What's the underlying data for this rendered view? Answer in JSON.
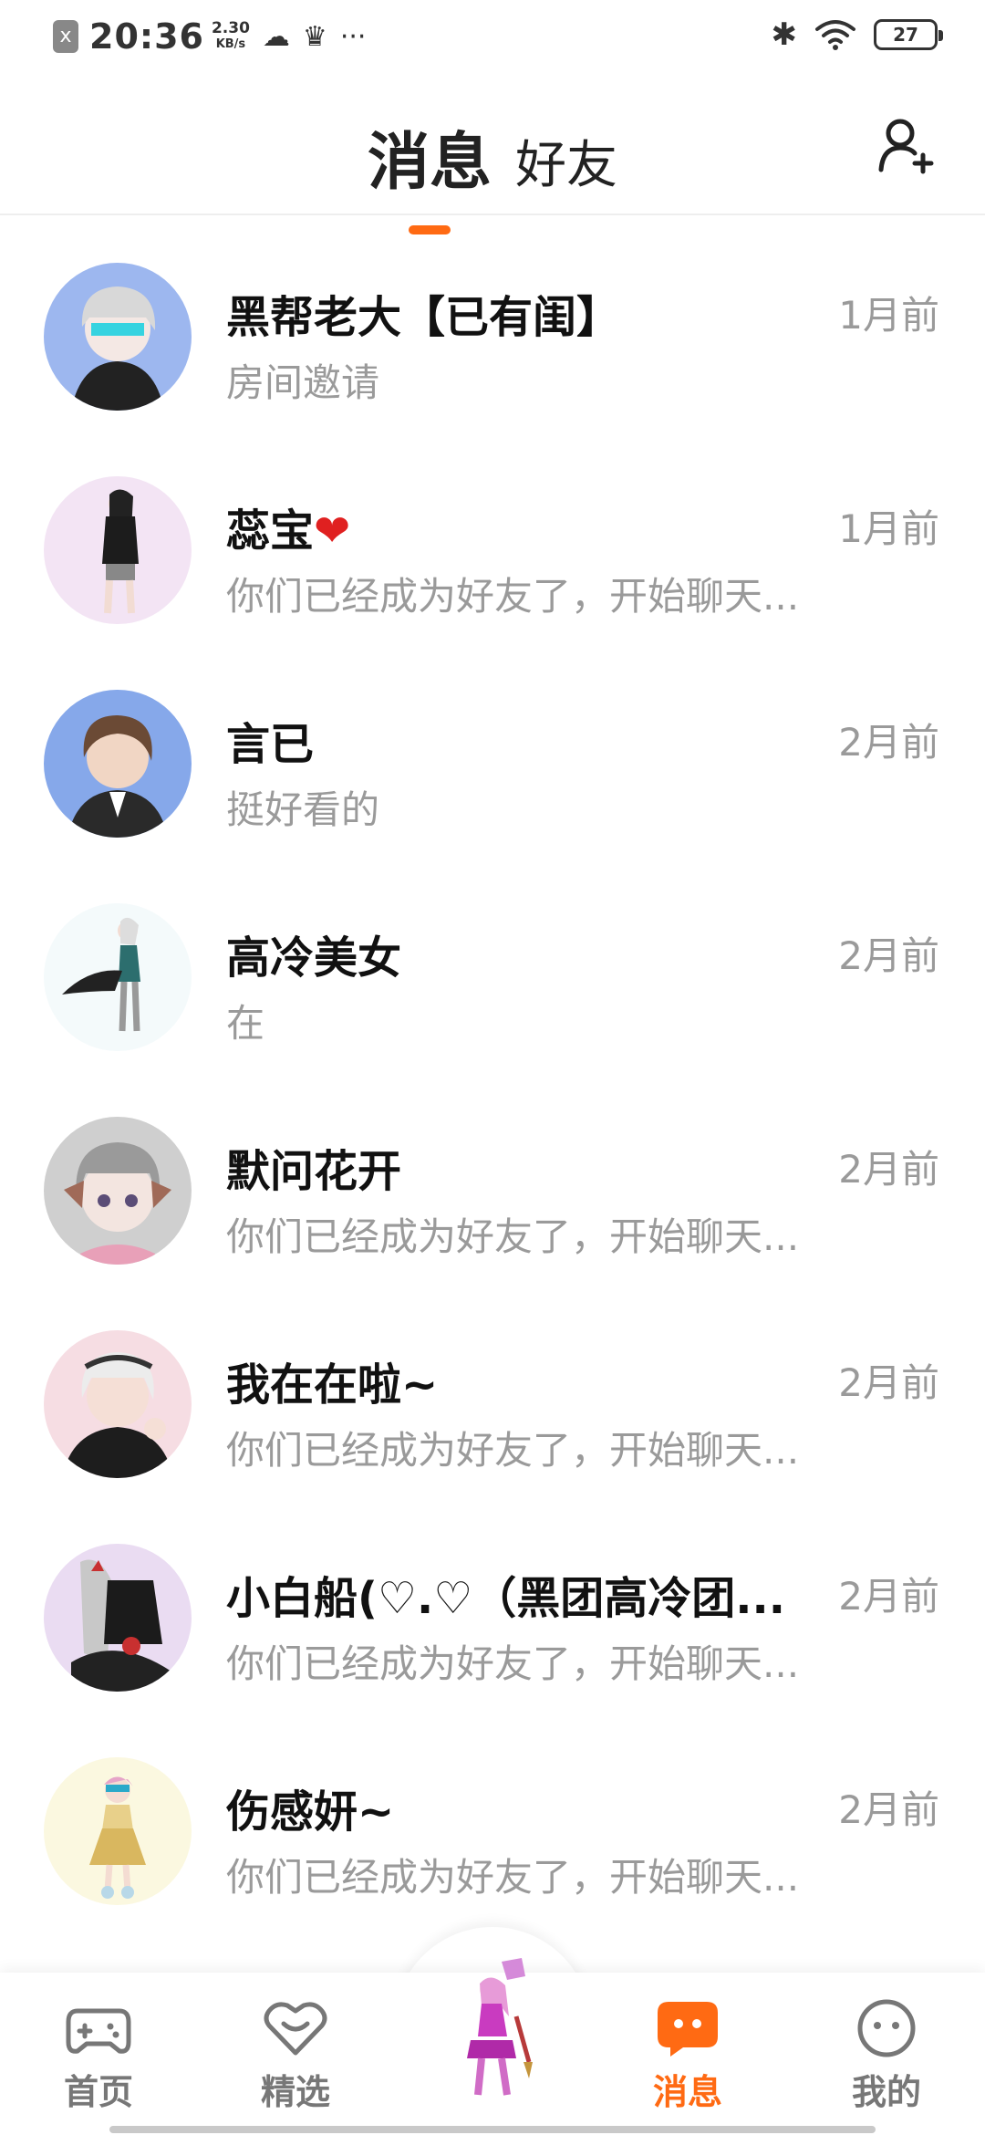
{
  "status_bar": {
    "close_icon_glyph": "x",
    "time": "20:36",
    "speed_value": "2.30",
    "speed_unit": "KB/s",
    "icons": [
      "cloud-icon",
      "crown-icon",
      "more-icon"
    ],
    "right_icons": [
      "bluetooth-icon",
      "wifi-icon",
      "battery-icon"
    ],
    "battery": "27"
  },
  "header": {
    "tabs": [
      {
        "label": "消息",
        "active": true
      },
      {
        "label": "好友",
        "active": false
      }
    ],
    "accent_color": "#ff6a13",
    "add_friend_icon": "add-user-icon"
  },
  "conversations": [
    {
      "name": "黑帮老大【已有闺】",
      "preview": "房间邀请",
      "time": "1月前"
    },
    {
      "name": "蕊宝",
      "name_suffix": "❤",
      "preview": "你们已经成为好友了，开始聊天...",
      "time": "1月前"
    },
    {
      "name": "言已",
      "preview": "挺好看的",
      "time": "2月前"
    },
    {
      "name": "高冷美女",
      "preview": "在",
      "time": "2月前"
    },
    {
      "name": "默问花开",
      "preview": "你们已经成为好友了，开始聊天...",
      "time": "2月前"
    },
    {
      "name": "我在在啦~",
      "preview": "你们已经成为好友了，开始聊天...",
      "time": "2月前"
    },
    {
      "name": "小白船(♡.♡（黑团高冷团...",
      "preview": "你们已经成为好友了，开始聊天...",
      "time": "2月前"
    },
    {
      "name": "伤感妍~",
      "preview": "你们已经成为好友了，开始聊天...",
      "time": "2月前"
    }
  ],
  "bottom_nav": {
    "items": [
      {
        "label": "首页",
        "icon": "gamepad-icon",
        "active": false
      },
      {
        "label": "精选",
        "icon": "heart-badge-icon",
        "active": false
      },
      {
        "label": "消息",
        "icon": "message-icon",
        "active": true
      },
      {
        "label": "我的",
        "icon": "face-icon",
        "active": false
      }
    ],
    "center_icon": "avatar-figure-icon"
  }
}
